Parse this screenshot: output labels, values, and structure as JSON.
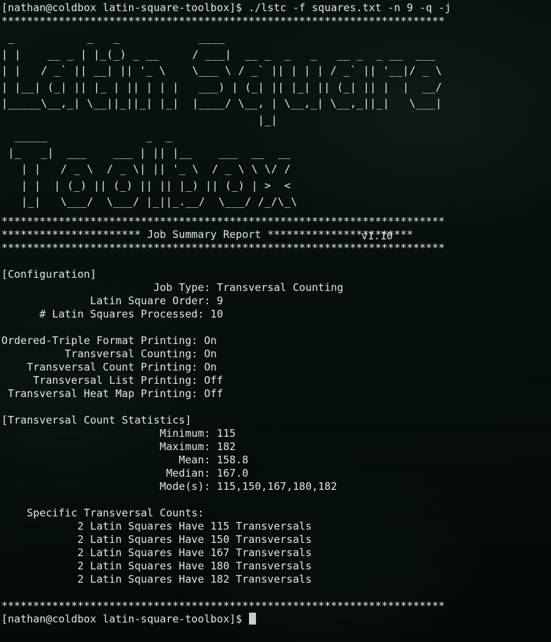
{
  "terminal": {
    "prompt": "[nathan@coldbox latin-square-toolbox]$",
    "command": " ./lstc -f squares.txt -n 9 -q -j",
    "command_line": "[nathan@coldbox latin-square-toolbox]$ ./lstc -f squares.txt -n 9 -q -j",
    "rule": "**********************************************************************",
    "header_line": "********************** Job Summary Report ***********************",
    "banner_version": "v1.10",
    "banner_ascii": [
      " _           _   _            ____                                  ",
      "| |    __ _ | |_(_) _ __     / ___|  __ _  _   _   __ _  _ __  ___  ",
      "| |   / _` || __| || '_ \\    \\___ \\ / _` || | | | / _` || '__|/ _ \\ ",
      "| |__| (_| || |_ | || | | |   ___) | (_| || |_| || (_| || |  |  __/ ",
      "|_____\\__,_| \\__||_||_| |_|  |____/ \\__, | \\__,_| \\__,_||_|   \\___| ",
      "                                       |_|                          ",
      "  _____               _  _                                          ",
      " |_   _|  ___    ___ | || |__    ___  __  __                        ",
      "   | |   / _ \\  / _ \\| || '_ \\  / _ \\ \\ \\/ /                        ",
      "   | |  | (_) || (_) || || |_) || (_) | >  <                         ",
      "   |_|   \\___/  \\___/ |_||_.__/  \\___/ /_/\\_\\                       "
    ],
    "cursor_visible": true
  },
  "report": {
    "title": "Job Summary Report",
    "sections": [
      {
        "heading": "[Configuration]",
        "rows": [
          {
            "label": "Job Type:",
            "value": "Transversal Counting",
            "indent": 24
          },
          {
            "label": "Latin Square Order:",
            "value": "9",
            "indent": 14
          },
          {
            "label": "# Latin Squares Processed:",
            "value": "10",
            "indent": 6
          }
        ]
      },
      {
        "heading": "",
        "rows": [
          {
            "label": "Ordered-Triple Format Printing:",
            "value": "On",
            "indent": 0
          },
          {
            "label": "Transversal Counting:",
            "value": "On",
            "indent": 10
          },
          {
            "label": "Transversal Count Printing:",
            "value": "On",
            "indent": 4
          },
          {
            "label": "Transversal List Printing:",
            "value": "Off",
            "indent": 5
          },
          {
            "label": "Transversal Heat Map Printing:",
            "value": "Off",
            "indent": 1
          }
        ]
      },
      {
        "heading": "[Transversal Count Statistics]",
        "rows": [
          {
            "label": "Minimum:",
            "value": "115",
            "indent": 25
          },
          {
            "label": "Maximum:",
            "value": "182",
            "indent": 25
          },
          {
            "label": "Mean:",
            "value": "158.8",
            "indent": 28
          },
          {
            "label": "Median:",
            "value": "167.0",
            "indent": 26
          },
          {
            "label": "Mode(s):",
            "value": "115,150,167,180,182",
            "indent": 25
          }
        ]
      }
    ],
    "specific_counts": {
      "heading": "Specific Transversal Counts:",
      "heading_indent": 4,
      "items": [
        {
          "squares": "2",
          "text_a": "Latin Squares Have",
          "count": "115",
          "text_b": "Transversals"
        },
        {
          "squares": "2",
          "text_a": "Latin Squares Have",
          "count": "150",
          "text_b": "Transversals"
        },
        {
          "squares": "2",
          "text_a": "Latin Squares Have",
          "count": "167",
          "text_b": "Transversals"
        },
        {
          "squares": "2",
          "text_a": "Latin Squares Have",
          "count": "180",
          "text_b": "Transversals"
        },
        {
          "squares": "2",
          "text_a": "Latin Squares Have",
          "count": "182",
          "text_b": "Transversals"
        }
      ],
      "item_indent": 12
    }
  },
  "colors": {
    "background": "#050d0b",
    "foreground": "#e2e6e5",
    "cursor": "#c8cccb"
  }
}
